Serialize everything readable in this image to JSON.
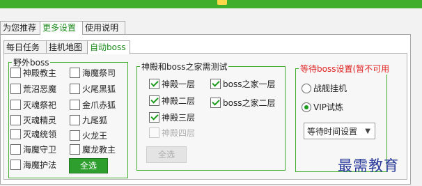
{
  "topbar": {
    "left_text": "",
    "right_text": ""
  },
  "main_tabs": [
    {
      "label": "为您推荐",
      "active": false
    },
    {
      "label": "更多设置",
      "active": true
    },
    {
      "label": "使用说明",
      "active": false
    }
  ],
  "sub_tabs": [
    {
      "label": "每日任务",
      "active": false
    },
    {
      "label": "挂机地图",
      "active": false
    },
    {
      "label": "自动boss",
      "active": true
    }
  ],
  "wild_boss": {
    "title": "野外boss",
    "items": [
      {
        "label": "神殿教主",
        "checked": false
      },
      {
        "label": "海魔祭司",
        "checked": false
      },
      {
        "label": "荒沼恶魔",
        "checked": false
      },
      {
        "label": "火尾黑狐",
        "checked": false
      },
      {
        "label": "灭魂祭祀",
        "checked": false
      },
      {
        "label": "金爪赤狐",
        "checked": false
      },
      {
        "label": "灭魂精灵",
        "checked": false
      },
      {
        "label": "九尾狐",
        "checked": false
      },
      {
        "label": "灭魂统领",
        "checked": false
      },
      {
        "label": "火龙王",
        "checked": false
      },
      {
        "label": "海魔守卫",
        "checked": false
      },
      {
        "label": "魔龙教主",
        "checked": false
      },
      {
        "label": "海魔护法",
        "checked": false
      }
    ],
    "select_all": "全选"
  },
  "temple": {
    "title": "神殿和boss之家需测试",
    "items": [
      {
        "label": "神殿一层",
        "checked": true,
        "disabled": false
      },
      {
        "label": "boss之家一层",
        "checked": true,
        "disabled": false
      },
      {
        "label": "神殿二层",
        "checked": true,
        "disabled": false
      },
      {
        "label": "boss之家二层",
        "checked": true,
        "disabled": false
      },
      {
        "label": "神殿三层",
        "checked": true,
        "disabled": false
      },
      {
        "label": "神殿四层",
        "checked": false,
        "disabled": true
      }
    ],
    "select_all": "全选"
  },
  "wait_boss": {
    "title": "等待boss设置(暂不可用",
    "options": [
      {
        "label": "战舰挂机",
        "selected": false
      },
      {
        "label": "VIP试炼",
        "selected": true
      }
    ],
    "dropdown_value": "等待时间设置"
  },
  "watermark": {
    "text": "最需教育"
  },
  "colors": {
    "accent": "#3fae2a",
    "warning": "#e02020",
    "watermark": "#2a3a9a"
  }
}
